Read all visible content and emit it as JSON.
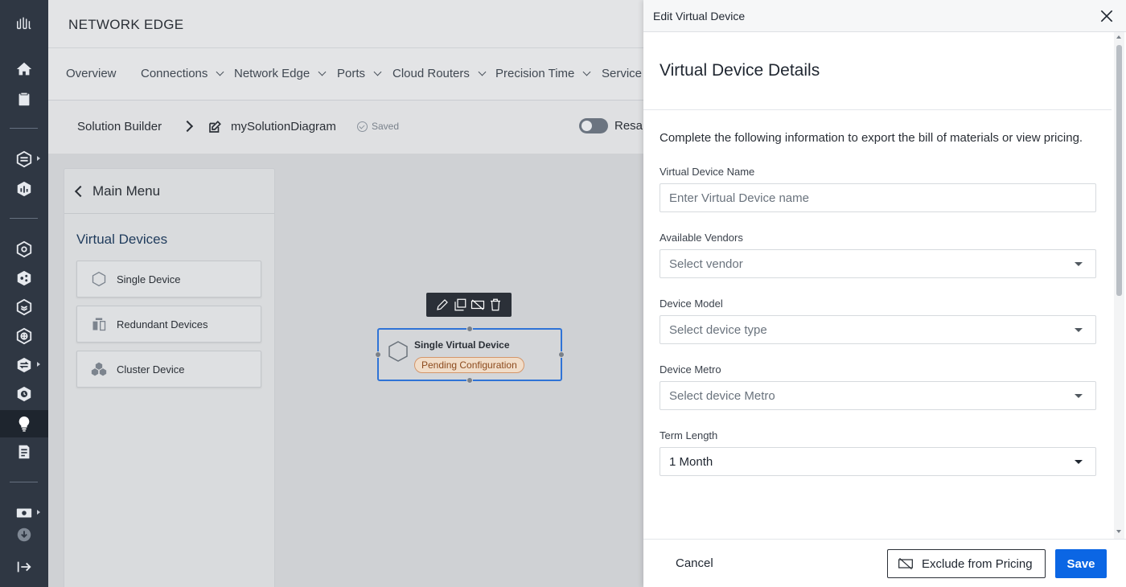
{
  "app": {
    "title": "NETWORK EDGE"
  },
  "nav": {
    "items": [
      {
        "label": "Overview",
        "has_dropdown": false
      },
      {
        "label": "Connections",
        "has_dropdown": true
      },
      {
        "label": "Network Edge",
        "has_dropdown": true
      },
      {
        "label": "Ports",
        "has_dropdown": true
      },
      {
        "label": "Cloud Routers",
        "has_dropdown": true
      },
      {
        "label": "Precision Time",
        "has_dropdown": true
      },
      {
        "label": "Service T",
        "has_dropdown": false
      }
    ]
  },
  "breadcrumb": {
    "root": "Solution Builder",
    "diagram_name": "mySolutionDiagram",
    "status": "Saved",
    "toggle_label": "Resal"
  },
  "side_menu": {
    "back_label": "Main Menu",
    "section_title": "Virtual Devices",
    "items": [
      {
        "label": "Single Device",
        "icon": "hexagon-icon"
      },
      {
        "label": "Redundant Devices",
        "icon": "redundant-devices-icon"
      },
      {
        "label": "Cluster Device",
        "icon": "cluster-icon"
      }
    ]
  },
  "node": {
    "title": "Single Virtual Device",
    "status": "Pending Configuration",
    "toolbar": [
      "edit-icon",
      "duplicate-icon",
      "exclude-pricing-icon",
      "delete-icon"
    ]
  },
  "drawer": {
    "title": "Edit Virtual Device",
    "subtitle": "Virtual Device Details",
    "intro": "Complete the following information to export the bill of materials or view pricing.",
    "fields": {
      "name": {
        "label": "Virtual Device Name",
        "placeholder": "Enter Virtual Device name"
      },
      "vendor": {
        "label": "Available Vendors",
        "placeholder": "Select vendor"
      },
      "model": {
        "label": "Device Model",
        "placeholder": "Select device type"
      },
      "metro": {
        "label": "Device Metro",
        "placeholder": "Select device Metro"
      },
      "term": {
        "label": "Term Length",
        "value": "1 Month"
      }
    },
    "footer": {
      "cancel": "Cancel",
      "exclude": "Exclude from Pricing",
      "save": "Save"
    }
  },
  "colors": {
    "rail_bg": "#2f3743",
    "accent_blue": "#0b66e4",
    "node_border": "#2f73d6",
    "pending_badge": "#f1ddc9"
  }
}
